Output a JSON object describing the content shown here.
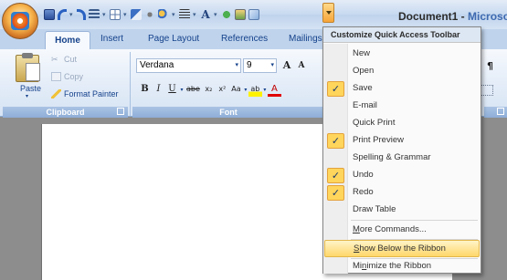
{
  "window": {
    "doc_name": "Document1",
    "title_sep": " - ",
    "app_name": "Microsoft"
  },
  "tabs": [
    "Home",
    "Insert",
    "Page Layout",
    "References",
    "Mailings"
  ],
  "clipboard": {
    "group_label": "Clipboard",
    "paste_label": "Paste",
    "cut_label": "Cut",
    "copy_label": "Copy",
    "format_painter_label": "Format Painter"
  },
  "font_group": {
    "group_label": "Font",
    "font_name": "Verdana",
    "font_size": "9",
    "grow_label": "A",
    "shrink_label": "A",
    "bold": "B",
    "italic": "I",
    "underline": "U",
    "strikethrough": "abe",
    "subscript": "x₂",
    "superscript": "x²",
    "change_case": "Aa",
    "highlight": "ab",
    "font_color": "A"
  },
  "paragraph_fragment": {
    "pilcrow": "¶"
  },
  "qat_menu": {
    "title": "Customize Quick Access Toolbar",
    "items": [
      {
        "label": "New",
        "checked": false
      },
      {
        "label": "Open",
        "checked": false
      },
      {
        "label": "Save",
        "checked": true
      },
      {
        "label": "E-mail",
        "checked": false
      },
      {
        "label": "Quick Print",
        "checked": false
      },
      {
        "label": "Print Preview",
        "checked": true
      },
      {
        "label": "Spelling & Grammar",
        "checked": false
      },
      {
        "label": "Undo",
        "checked": true
      },
      {
        "label": "Redo",
        "checked": true
      },
      {
        "label": "Draw Table",
        "checked": false
      }
    ],
    "more_commands": {
      "mnemonic": "M",
      "rest": "ore Commands..."
    },
    "show_below": {
      "mnemonic": "S",
      "rest": "how Below the Ribbon"
    },
    "minimize": {
      "pre": "Mi",
      "mnemonic": "n",
      "rest": "imize the Ribbon"
    },
    "check_glyph": "✓"
  },
  "colors": {
    "ribbon_text": "#15428b",
    "menu_highlight": "#ffd76a",
    "check_bg": "#ffd55b"
  }
}
